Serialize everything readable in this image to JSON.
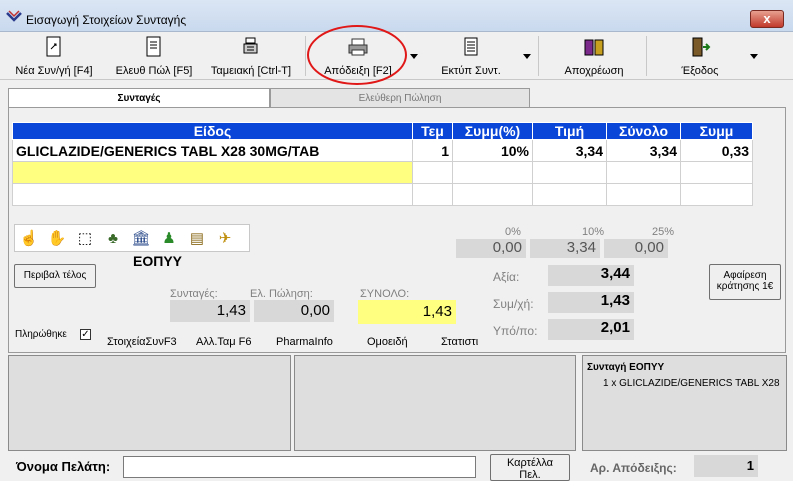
{
  "window": {
    "title": "Εισαγωγή Στοιχείων Συνταγής",
    "close_label": "x"
  },
  "toolbar": {
    "buttons": [
      {
        "label": "Νέα Συν/γή [F4]",
        "icon": "new-doc-icon"
      },
      {
        "label": "Ελευθ Πώλ [F5]",
        "icon": "doc-icon"
      },
      {
        "label": "Ταμειακή [Ctrl-T]",
        "icon": "cash-register-icon"
      },
      {
        "label": "Απόδειξη [F2]",
        "icon": "printer-icon"
      },
      {
        "label": "Εκτύπ Συντ.",
        "icon": "print-list-icon"
      },
      {
        "label": "Αποχρέωση",
        "icon": "book-icon"
      },
      {
        "label": "Έξοδος",
        "icon": "exit-door-icon"
      }
    ]
  },
  "tabs": {
    "active": "Συνταγές",
    "inactive": "Ελεύθερη Πώληση"
  },
  "grid": {
    "headers": [
      "Είδος",
      "Τεμ",
      "Συμμ(%)",
      "Τιμή",
      "Σύνολο",
      "Συμμ"
    ],
    "rows": [
      {
        "item": "GLICLAZIDE/GENERICS TABL X28 30MG/TAB",
        "qty": "1",
        "pct": "10%",
        "price": "3,34",
        "total": "3,34",
        "part": "0,33"
      }
    ]
  },
  "insurer": "ΕΟΠΥΥ",
  "env_fee_button": "Περιβαλ τέλος",
  "percent_cols": {
    "labels": [
      "0%",
      "10%",
      "25%"
    ],
    "values": [
      "0,00",
      "3,34",
      "0,00"
    ]
  },
  "summary": {
    "value_label": "Αξία:",
    "value": "3,44",
    "copay_label": "Συμ/χή:",
    "copay": "1,43",
    "remain_label": "Υπό/πο:",
    "remain": "2,01"
  },
  "deduct_button": {
    "line1": "Αφαίρεση",
    "line2": "κράτησης 1€"
  },
  "totals": {
    "rx_label": "Συνταγές:",
    "rx": "1,43",
    "free_label": "Ελ. Πώληση:",
    "free": "0,00",
    "sum_label": "ΣΥΝΟΛΟ:",
    "sum": "1,43"
  },
  "paid": {
    "label": "Πληρώθηκε",
    "checked": "✓"
  },
  "links": [
    "ΣτοιχείαΣυνF3",
    "Αλλ.Ταμ F6",
    "PharmaInfo",
    "Ομοειδή",
    "Στατιστι"
  ],
  "tree": {
    "root": "Συνταγή ΕΟΠΥΥ",
    "child": "1 x GLICLAZIDE/GENERICS TABL X28"
  },
  "bottom": {
    "customer_label": "Όνομα Πελάτη:",
    "card_button": "Καρτέλλα",
    "card_button_2": "Πελ.",
    "receipt_label": "Αρ. Απόδειξης:",
    "receipt_no": "1"
  }
}
